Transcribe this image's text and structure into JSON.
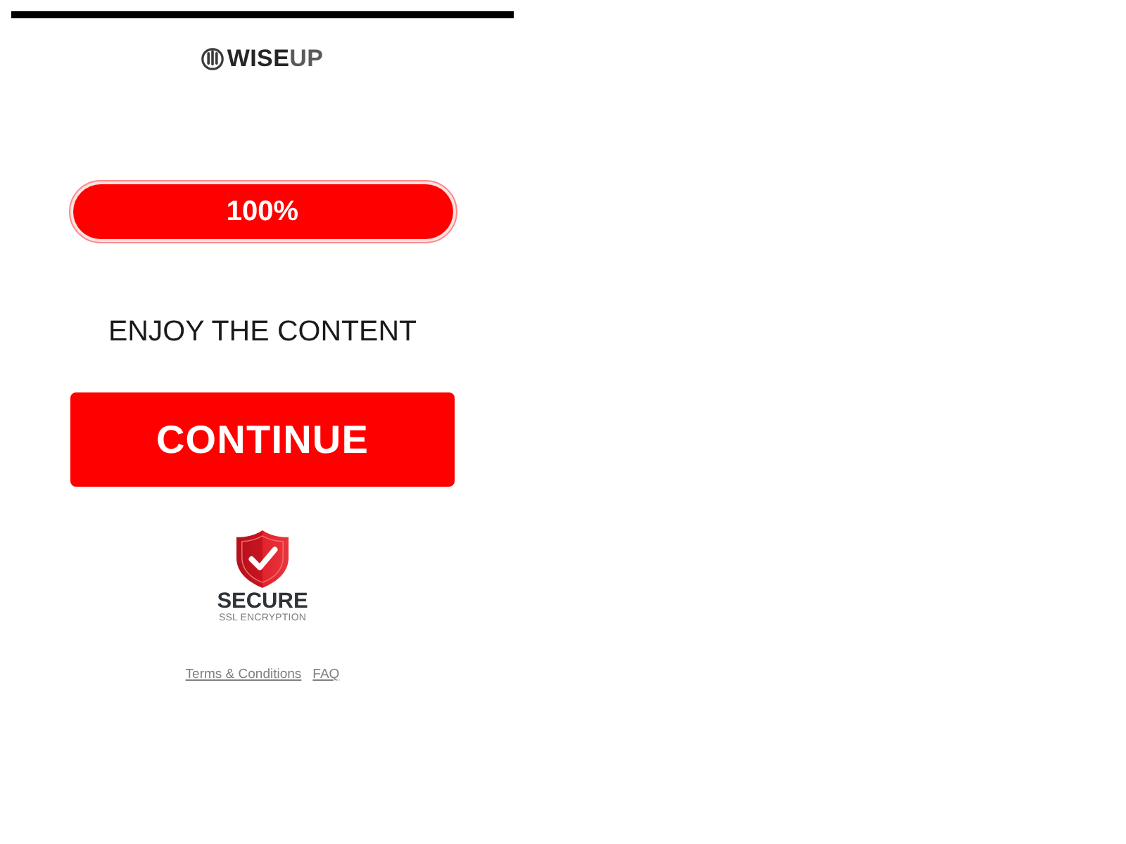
{
  "header": {
    "logo": {
      "parts": [
        "WISE",
        "UP"
      ]
    }
  },
  "progress": {
    "label": "100%",
    "level": 1
  },
  "heading": "ENJOY THE CONTENT",
  "primary_button": {
    "label": "CONTINUE"
  },
  "secure_badge": {
    "title": "SECURE",
    "subtitle": "SSL ENCRYPTION"
  },
  "footer_links": [
    "Terms & Conditions",
    "FAQ"
  ]
}
